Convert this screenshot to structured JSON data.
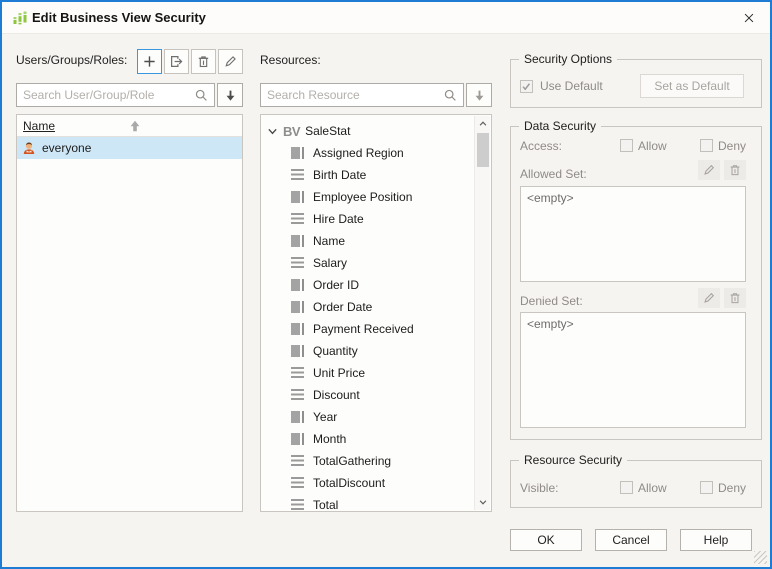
{
  "window": {
    "title": "Edit Business View Security"
  },
  "users_panel": {
    "label": "Users/Groups/Roles:",
    "search_placeholder": "Search User/Group/Role",
    "list_header": "Name",
    "rows": [
      {
        "name": "everyone",
        "selected": true
      }
    ]
  },
  "resources_panel": {
    "label": "Resources:",
    "search_placeholder": "Search Resource",
    "tree": {
      "root_badge": "BV",
      "root_label": "SaleStat",
      "items": [
        {
          "label": "Assigned Region",
          "icon": "dimension"
        },
        {
          "label": "Birth Date",
          "icon": "measure"
        },
        {
          "label": "Employee Position",
          "icon": "dimension"
        },
        {
          "label": "Hire Date",
          "icon": "measure"
        },
        {
          "label": "Name",
          "icon": "dimension"
        },
        {
          "label": "Salary",
          "icon": "measure"
        },
        {
          "label": "Order ID",
          "icon": "dimension"
        },
        {
          "label": "Order Date",
          "icon": "dimension"
        },
        {
          "label": "Payment Received",
          "icon": "dimension"
        },
        {
          "label": "Quantity",
          "icon": "dimension"
        },
        {
          "label": "Unit Price",
          "icon": "measure"
        },
        {
          "label": "Discount",
          "icon": "measure"
        },
        {
          "label": "Year",
          "icon": "dimension"
        },
        {
          "label": "Month",
          "icon": "dimension"
        },
        {
          "label": "TotalGathering",
          "icon": "measure"
        },
        {
          "label": "TotalDiscount",
          "icon": "measure"
        },
        {
          "label": "Total",
          "icon": "measure"
        }
      ]
    }
  },
  "security_options": {
    "title": "Security Options",
    "use_default_label": "Use Default",
    "use_default_checked": true,
    "set_as_default_label": "Set as Default"
  },
  "data_security": {
    "title": "Data Security",
    "access_label": "Access:",
    "allow_label": "Allow",
    "deny_label": "Deny",
    "allowed_set_label": "Allowed Set:",
    "allowed_set_value": "<empty>",
    "denied_set_label": "Denied Set:",
    "denied_set_value": "<empty>"
  },
  "resource_security": {
    "title": "Resource Security",
    "visible_label": "Visible:",
    "allow_label": "Allow",
    "deny_label": "Deny"
  },
  "footer": {
    "ok_label": "OK",
    "cancel_label": "Cancel",
    "help_label": "Help"
  },
  "colors": {
    "window_border": "#1f7cd4",
    "selection": "#cde7f6",
    "logo_green": "#8dc63f"
  }
}
